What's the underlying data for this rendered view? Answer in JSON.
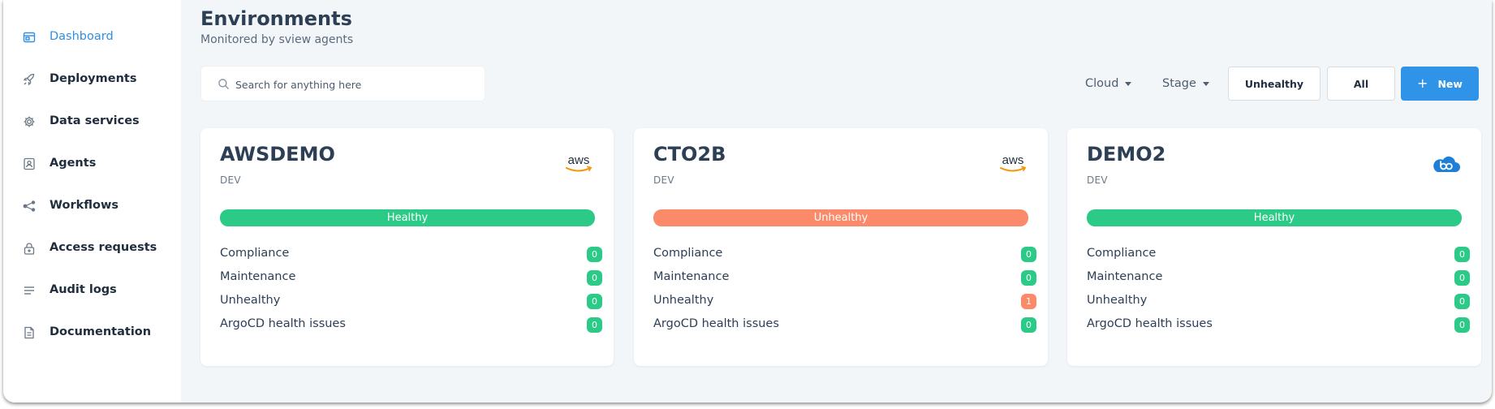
{
  "sidebar": {
    "items": [
      {
        "label": "Dashboard",
        "icon": "dashboard-icon",
        "active": true
      },
      {
        "label": "Deployments",
        "icon": "rocket-icon"
      },
      {
        "label": "Data services",
        "icon": "gear-icon"
      },
      {
        "label": "Agents",
        "icon": "agent-icon"
      },
      {
        "label": "Workflows",
        "icon": "workflow-icon"
      },
      {
        "label": "Access requests",
        "icon": "lock-icon"
      },
      {
        "label": "Audit logs",
        "icon": "list-icon"
      },
      {
        "label": "Documentation",
        "icon": "document-icon"
      }
    ]
  },
  "header": {
    "title": "Environments",
    "subtitle": "Monitored by sview agents"
  },
  "toolbar": {
    "search_placeholder": "Search for anything here",
    "cloud_label": "Cloud",
    "stage_label": "Stage",
    "unhealthy_label": "Unhealthy",
    "all_label": "All",
    "new_label": "New"
  },
  "colors": {
    "accent": "#2f94e8",
    "healthy": "#2bcb87",
    "unhealthy": "#fb8a6a"
  },
  "environments": [
    {
      "name": "AWSDEMO",
      "stage": "DEV",
      "logo": "aws-logo",
      "status": "Healthy",
      "metrics": [
        {
          "label": "Compliance",
          "value": "0"
        },
        {
          "label": "Maintenance",
          "value": "0"
        },
        {
          "label": "Unhealthy",
          "value": "0"
        },
        {
          "label": "ArgoCD health issues",
          "value": "0"
        }
      ]
    },
    {
      "name": "CTO2B",
      "stage": "DEV",
      "logo": "aws-logo",
      "status": "Unhealthy",
      "metrics": [
        {
          "label": "Compliance",
          "value": "0"
        },
        {
          "label": "Maintenance",
          "value": "0"
        },
        {
          "label": "Unhealthy",
          "value": "1"
        },
        {
          "label": "ArgoCD health issues",
          "value": "0"
        }
      ]
    },
    {
      "name": "DEMO2",
      "stage": "DEV",
      "logo": "cloud-logo",
      "status": "Healthy",
      "metrics": [
        {
          "label": "Compliance",
          "value": "0"
        },
        {
          "label": "Maintenance",
          "value": "0"
        },
        {
          "label": "Unhealthy",
          "value": "0"
        },
        {
          "label": "ArgoCD health issues",
          "value": "0"
        }
      ]
    }
  ]
}
